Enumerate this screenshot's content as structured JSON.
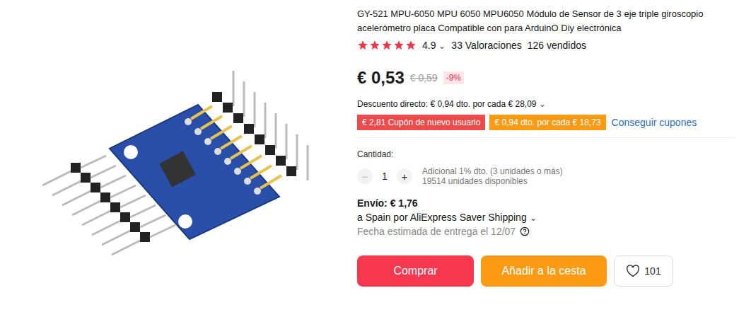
{
  "product": {
    "title": "GY-521 MPU-6050 MPU 6050 MPU6050 Módulo de Sensor de 3 eje triple giroscopio acelerómetro placa Compatible con para ArduinO Diy electrónica",
    "rating": {
      "stars": 5,
      "score": "4.9",
      "chevron": "⌄",
      "reviews": "33 Valoraciones",
      "sold": "126 vendidos"
    }
  },
  "price": {
    "current": "€ 0,53",
    "original": "€ 0,59",
    "discount": "-9%"
  },
  "direct_discount": {
    "text": "Descuento directo: € 0,94 dto. por cada € 28,09",
    "chevron": "⌄"
  },
  "coupons": [
    {
      "label": "€ 2,81 Cupón de nuevo usuario",
      "color": "#f04b4b"
    },
    {
      "label": "€ 0,94 dto. por cada € 18,73",
      "color": "#fd9a14"
    }
  ],
  "coupons_link": "Conseguir cupones",
  "quantity": {
    "label": "Cantidad:",
    "minus": "−",
    "minus_disabled": true,
    "value": "1",
    "plus": "+",
    "extra": "Adicional 1% dto. (3 unidades o más)",
    "available": "19514 unidades disponibles"
  },
  "shipping": {
    "cost": "Envío: € 1,76",
    "route": "a Spain por AliExpress Saver Shipping",
    "chevron": "⌄",
    "delivery": "Fecha estimada de entrega el 12/07"
  },
  "buttons": [
    {
      "label": "Comprar",
      "kind": "primary"
    },
    {
      "label": "Añadir a la cesta",
      "kind": "secondary"
    }
  ],
  "wishlist": {
    "count": "101"
  }
}
